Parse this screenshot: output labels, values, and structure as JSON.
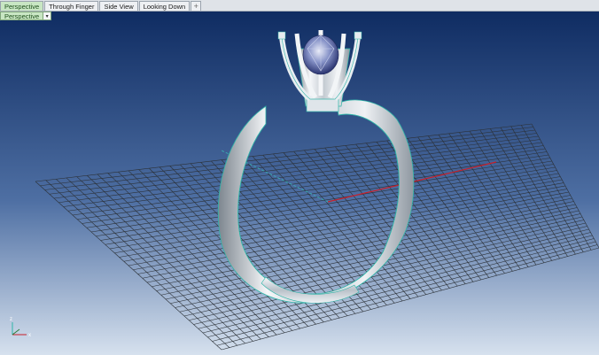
{
  "tabs": [
    {
      "label": "Perspective",
      "active": true
    },
    {
      "label": "Through Finger",
      "active": false
    },
    {
      "label": "Side View",
      "active": false
    },
    {
      "label": "Looking Down",
      "active": false
    }
  ],
  "tab_add_symbol": "+",
  "view_dropdown": {
    "label": "Perspective",
    "arrow": "▾"
  },
  "axis_triad": {
    "z": "z",
    "x": "x"
  },
  "colors": {
    "viewport_top": "#0f2c62",
    "viewport_mid": "#4e6fa3",
    "viewport_bottom": "#d6e1ee",
    "grid": "#2b3036",
    "x_axis": "#c8202a",
    "y_axis": "#3aa7b0",
    "metal": "#dde3e8",
    "edge": "#2fb5a8",
    "gem": "#6a78b8",
    "tab_active": "#c8e6c3"
  }
}
